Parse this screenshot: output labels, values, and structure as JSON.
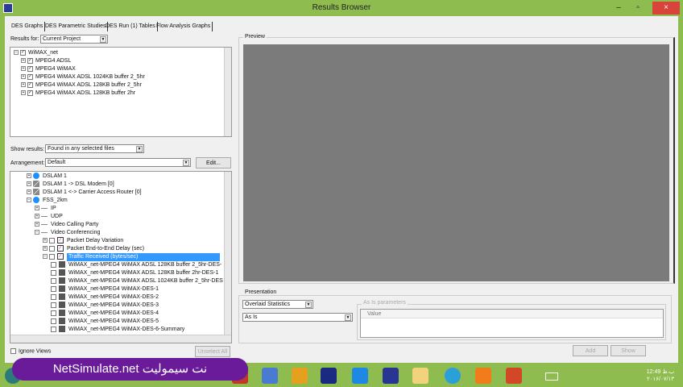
{
  "window": {
    "title": "Results Browser",
    "minimize": "–",
    "maximize": "▫",
    "close": "×"
  },
  "tabs": [
    "DES Graphs",
    "DES Parametric Studies",
    "DES Run (1) Tables",
    "Flow Analysis Graphs"
  ],
  "results_for": {
    "label": "Results for:",
    "value": "Current Project"
  },
  "project_tree": [
    {
      "label": "WiMAX_net",
      "checked": true,
      "level": 0
    },
    {
      "label": "MPEG4  ADSL",
      "checked": true,
      "level": 1
    },
    {
      "label": "MPEG4 WiMAX",
      "checked": true,
      "level": 1
    },
    {
      "label": "MPEG4 WiMAX ADSL 1024KB buffer 2_5hr",
      "checked": true,
      "level": 1
    },
    {
      "label": "MPEG4 WiMAX ADSL 128KB buffer 2_5hr",
      "checked": true,
      "level": 1
    },
    {
      "label": "MPEG4 WiMAX ADSL 128KB buffer 2hr",
      "checked": true,
      "level": 1
    }
  ],
  "show_results": {
    "label": "Show results:",
    "value": "Found in any selected files"
  },
  "arrangement": {
    "label": "Arrangement:",
    "value": "Default",
    "edit_button": "Edit..."
  },
  "stats_tree": [
    {
      "label": "DSLAM 1",
      "icon": "node",
      "indent": 0
    },
    {
      "label": "DSLAM 1 -> DSL Modem [0]",
      "icon": "link",
      "indent": 0
    },
    {
      "label": "DSLAM 1 <-> Carrier Access Router [0]",
      "icon": "link",
      "indent": 0
    },
    {
      "label": "FSS_2km",
      "icon": "node",
      "indent": 0,
      "expanded": true
    },
    {
      "label": "IP",
      "icon": "none",
      "indent": 1
    },
    {
      "label": "UDP",
      "icon": "none",
      "indent": 1
    },
    {
      "label": "Video Calling Party",
      "icon": "none",
      "indent": 1
    },
    {
      "label": "Video Conferencing",
      "icon": "none",
      "indent": 1,
      "expanded": true
    },
    {
      "label": "Packet Delay Variation",
      "icon": "graph",
      "indent": 2
    },
    {
      "label": "Packet End-to-End Delay (sec)",
      "icon": "graph",
      "indent": 2
    },
    {
      "label": "Traffic Received (bytes/sec)",
      "icon": "graph",
      "indent": 2,
      "selected": true,
      "expanded": true
    },
    {
      "label": "WiMAX_net-MPEG4 WiMAX ADSL 128KB buffer 2_5hr-DES-",
      "icon": "stat",
      "indent": 3
    },
    {
      "label": "WiMAX_net-MPEG4 WiMAX ADSL 128KB buffer 2hr-DES-1",
      "icon": "stat",
      "indent": 3
    },
    {
      "label": "WiMAX_net-MPEG4 WiMAX ADSL 1024KB buffer 2_5hr-DES",
      "icon": "stat",
      "indent": 3
    },
    {
      "label": "WiMAX_net-MPEG4 WiMAX-DES-1",
      "icon": "stat",
      "indent": 3
    },
    {
      "label": "WiMAX_net-MPEG4 WiMAX-DES-2",
      "icon": "stat",
      "indent": 3
    },
    {
      "label": "WiMAX_net-MPEG4 WiMAX-DES-3",
      "icon": "stat",
      "indent": 3
    },
    {
      "label": "WiMAX_net-MPEG4 WiMAX-DES-4",
      "icon": "stat",
      "indent": 3
    },
    {
      "label": "WiMAX_net-MPEG4 WiMAX-DES-5",
      "icon": "stat",
      "indent": 3
    },
    {
      "label": "WiMAX_net-MPEG4 WiMAX-DES-6-Summary",
      "icon": "stat",
      "indent": 3
    }
  ],
  "ignore_views": {
    "label": "Ignore Views",
    "checked": false
  },
  "unselect_all": "Unselect All",
  "preview": {
    "label": "Preview"
  },
  "presentation": {
    "label": "Presentation",
    "mode": "Overlaid Statistics",
    "filter": "As Is",
    "param_group": "As Is parameters",
    "param_column": "Value"
  },
  "add_button": "Add",
  "show_button": "Show",
  "banner": "NetSimulate.net نت سیمولیت",
  "clock": {
    "time": "12:49 ب.ظ",
    "date": "۲۰۱۶/۰۷/۱۳"
  },
  "colors": {
    "titlebar": "#8fbc4f",
    "selection": "#3399ff",
    "preview_bg": "#7b7b7b",
    "banner": "#6a1b9a",
    "close": "#d9443a"
  }
}
